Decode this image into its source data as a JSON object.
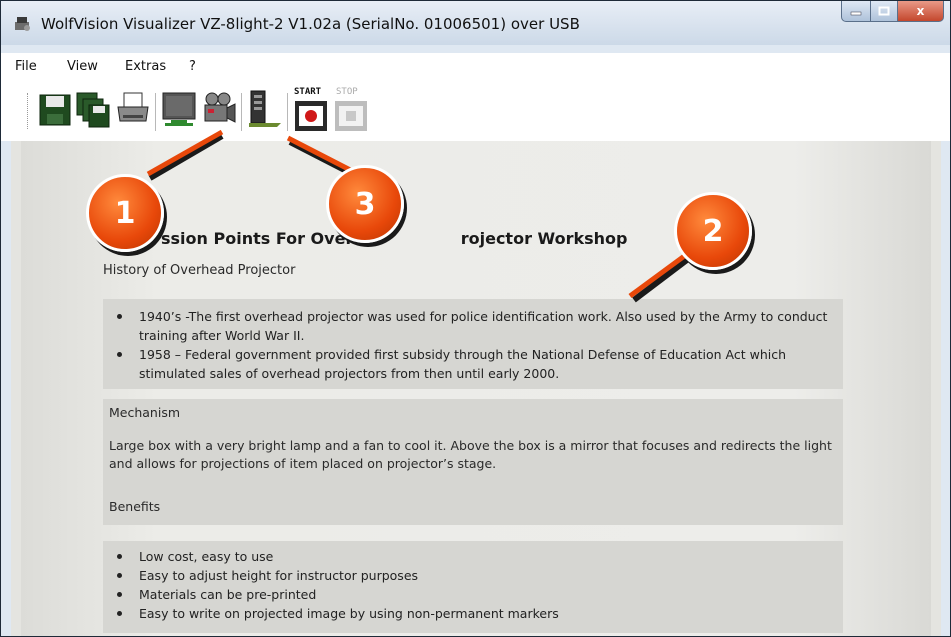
{
  "window": {
    "title": "WolfVision Visualizer VZ-8light-2 V1.02a (SerialNo. 01006501) over USB",
    "close_glyph": "x"
  },
  "menu": [
    "File",
    "View",
    "Extras",
    "?"
  ],
  "toolbar": {
    "start_label": "START",
    "stop_label": "STOP",
    "icons": [
      "save-icon",
      "save-all-icon",
      "print-icon",
      "monitor-icon",
      "camera-icon",
      "scanner-icon",
      "record-start-icon",
      "record-stop-icon"
    ]
  },
  "document": {
    "title": "ssion Points For Overh        rojector Workshop",
    "title_visible_left": "ssion Points For Overh",
    "title_visible_right": "rojector Workshop",
    "subtitle": "History of Overhead Projector",
    "history_bullets": [
      "1940’s -The first overhead projector was used for police identification work. Also used by the Army to conduct training after World War II.",
      "1958 – Federal government provided first subsidy through the National Defense of Education Act which stimulated sales of overhead projectors from then until early 2000."
    ],
    "mechanism_heading": "Mechanism",
    "mechanism_text": "Large box with a very bright lamp and a fan to cool it. Above the box is a mirror that focuses and redirects the light and allows for projections of item placed on projector’s stage.",
    "benefits_heading": "Benefits",
    "benefit_bullets": [
      "Low cost, easy to use",
      "Easy to adjust height for instructor purposes",
      "Materials can be pre-printed",
      "Easy to write on projected image by using non-permanent markers"
    ]
  },
  "annotations": {
    "badges": [
      "1",
      "2",
      "3"
    ],
    "color": "#e8480a"
  }
}
